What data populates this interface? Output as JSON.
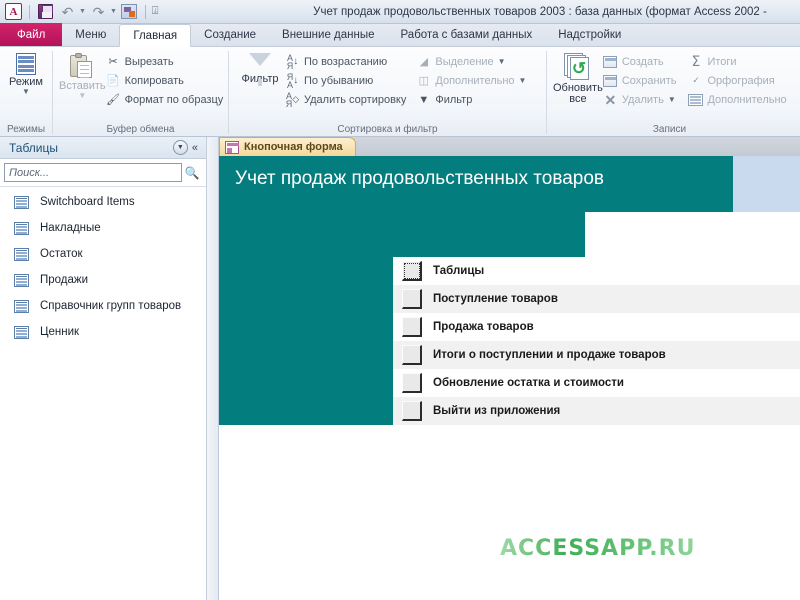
{
  "window": {
    "title": "Учет продаж продовольственных товаров 2003 : база данных (формат Access 2002 - ",
    "app_icon": "access-logo-icon",
    "quick_access": [
      {
        "name": "save-icon",
        "label": "Сохранить"
      },
      {
        "name": "undo-icon",
        "label": "Отменить"
      },
      {
        "name": "redo-icon",
        "label": "Вернуть"
      },
      {
        "name": "run-macro-icon",
        "label": "Выполнить"
      },
      {
        "name": "customize-qat-icon",
        "label": "Настройка панели быстрого доступа"
      }
    ]
  },
  "ribbon": {
    "tabs": [
      {
        "label": "Файл",
        "active": false,
        "kind": "file"
      },
      {
        "label": "Меню",
        "active": false,
        "kind": "normal"
      },
      {
        "label": "Главная",
        "active": true,
        "kind": "normal"
      },
      {
        "label": "Создание",
        "active": false,
        "kind": "normal"
      },
      {
        "label": "Внешние данные",
        "active": false,
        "kind": "normal"
      },
      {
        "label": "Работа с базами данных",
        "active": false,
        "kind": "normal"
      },
      {
        "label": "Надстройки",
        "active": false,
        "kind": "normal"
      }
    ],
    "groups": {
      "views": {
        "label": "Режимы",
        "big_button": {
          "line1": "Режим",
          "icon": "datasheet-view-icon"
        }
      },
      "clipboard": {
        "label": "Буфер обмена",
        "paste": {
          "label": "Вставить",
          "icon": "paste-icon"
        },
        "items": [
          {
            "label": "Вырезать",
            "icon": "scissors-icon"
          },
          {
            "label": "Копировать",
            "icon": "copy-icon"
          },
          {
            "label": "Формат по образцу",
            "icon": "format-painter-icon"
          }
        ]
      },
      "sortfilter": {
        "label": "Сортировка и фильтр",
        "filter": {
          "label": "Фильтр",
          "icon": "funnel-icon"
        },
        "column_a": [
          {
            "label": "По возрастанию",
            "icon": "sort-asc-icon"
          },
          {
            "label": "По убыванию",
            "icon": "sort-desc-icon"
          },
          {
            "label": "Удалить сортировку",
            "icon": "clear-sort-icon"
          }
        ],
        "column_b": [
          {
            "label": "Выделение",
            "icon": "selection-icon",
            "has_caret": true
          },
          {
            "label": "Дополнительно",
            "icon": "advanced-filter-icon",
            "has_caret": true
          },
          {
            "label": "Фильтр",
            "icon": "toggle-filter-icon",
            "has_caret": false
          }
        ]
      },
      "records": {
        "label": "Записи",
        "refresh": {
          "line1": "Обновить",
          "line2": "все",
          "icon": "refresh-all-icon"
        },
        "column_a": [
          {
            "label": "Создать",
            "icon": "new-record-icon"
          },
          {
            "label": "Сохранить",
            "icon": "save-record-icon"
          },
          {
            "label": "Удалить",
            "icon": "delete-record-icon",
            "has_caret": true
          }
        ],
        "column_b": [
          {
            "label": "Итоги",
            "icon": "totals-icon"
          },
          {
            "label": "Орфография",
            "icon": "spelling-icon"
          },
          {
            "label": "Дополнительно",
            "icon": "more-records-icon"
          }
        ]
      }
    }
  },
  "navpane": {
    "title": "Таблицы",
    "dropdown_icon": "chevron-down-icon",
    "collapse_icon": "collapse-pane-icon",
    "search": {
      "value": "",
      "placeholder": "Поиск...",
      "icon": "search-icon"
    },
    "items": [
      {
        "label": "Switchboard Items",
        "icon": "table-icon"
      },
      {
        "label": "Накладные",
        "icon": "table-icon"
      },
      {
        "label": "Остаток",
        "icon": "table-icon"
      },
      {
        "label": "Продажи",
        "icon": "table-icon"
      },
      {
        "label": "Справочник групп товаров",
        "icon": "table-icon"
      },
      {
        "label": "Ценник",
        "icon": "table-icon"
      }
    ]
  },
  "document": {
    "tab": {
      "label": "Кнопочная форма",
      "icon": "form-icon"
    },
    "form": {
      "header_title": "Учет продаж продовольственных товаров",
      "menu_items": [
        {
          "label": "Таблицы",
          "focused": true
        },
        {
          "label": "Поступление товаров",
          "focused": false
        },
        {
          "label": "Продажа товаров",
          "focused": false
        },
        {
          "label": "Итоги  о поступлении и продаже товаров",
          "focused": false
        },
        {
          "label": "Обновление остатка и стоимости",
          "focused": false
        },
        {
          "label": "Выйти из приложения",
          "focused": false
        }
      ],
      "watermark": "ACCESSAPP.RU"
    }
  },
  "colors": {
    "file_tab": "#b2125a",
    "form_teal": "#047d7f",
    "header_blue": "#c9d9ee",
    "doc_tab": "#f6d79a",
    "watermark_green": "#3fae55"
  }
}
